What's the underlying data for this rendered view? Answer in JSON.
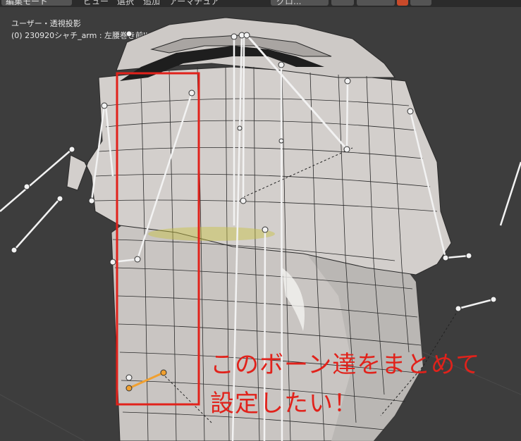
{
  "header": {
    "mode_label": "編集モード",
    "menu_view": "ビュー",
    "menu_select": "選択",
    "menu_add": "追加",
    "menu_armature": "アーマチュア",
    "pivot_label": "グロ..."
  },
  "overlay": {
    "view_name": "ユーザー・透視投影",
    "object_info": "(0) 230920シャチ_arm : 左腰巻き前IK.L"
  },
  "annotation": {
    "line1": "このボーン達をまとめて",
    "line2": "設定したい！"
  },
  "colors": {
    "selection_box": "#e1221b",
    "selected_bone": "#f0a030",
    "mesh_fill": "#c9c5c2",
    "wire": "#2a2a2a",
    "viewport_bg": "#3d3d3d"
  }
}
